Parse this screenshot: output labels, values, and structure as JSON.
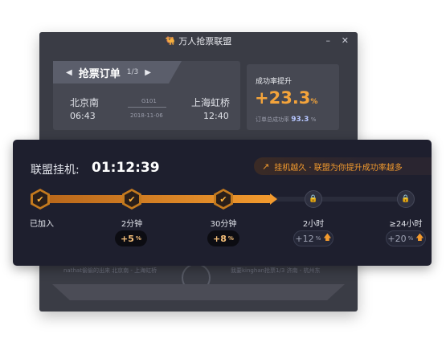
{
  "window": {
    "title": "万人抢票联盟",
    "minimize": "–",
    "close": "✕"
  },
  "order": {
    "title": "抢票订单",
    "page": "1/3",
    "prev": "◀",
    "next": "▶",
    "from": "北京南",
    "to": "上海虹桥",
    "train": "G101",
    "depart_time": "06:43",
    "date": "2018-11-06",
    "arrive_time": "12:40"
  },
  "success_rate": {
    "title": "成功率提升",
    "value": "+23.3",
    "unit": "%",
    "sub_label": "订单总成功率",
    "sub_value": "93.3",
    "sub_unit": "%"
  },
  "background_rows": [
    {
      "text": "nathat偷偷的出来  北京南 - 上海虹桥"
    },
    {
      "text": "我要kinghan抢票1/3   济南 - 杭州东"
    }
  ],
  "panel": {
    "label": "联盟挂机:",
    "elapsed": "01:12:39",
    "trend_icon": "trend-up-icon",
    "badge_text": "挂机越久 · 联盟为你提升成功率越多",
    "progress": 0.63,
    "accent": "#f29a2e",
    "steps": [
      {
        "label": "已加入",
        "status": "done",
        "bonus": "",
        "icon": "check-icon"
      },
      {
        "label": "2分钟",
        "status": "done",
        "bonus": "+5",
        "unit": "%",
        "icon": "check-icon"
      },
      {
        "label": "30分钟",
        "status": "done",
        "bonus": "+8",
        "unit": "%",
        "icon": "check-icon"
      },
      {
        "label": "2小时",
        "status": "locked",
        "bonus": "+12",
        "unit": "%",
        "icon": "lock-icon"
      },
      {
        "label": "≥24小时",
        "status": "locked",
        "bonus": "+20",
        "unit": "%",
        "icon": "lock-icon"
      }
    ]
  }
}
